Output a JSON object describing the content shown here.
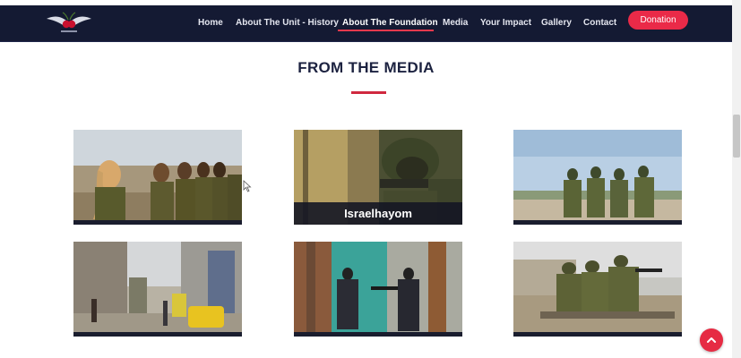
{
  "nav": {
    "items": [
      {
        "label": "Home"
      },
      {
        "label": "About The Unit - History"
      },
      {
        "label": "About The Foundation"
      },
      {
        "label": "Media"
      },
      {
        "label": "Your Impact"
      },
      {
        "label": "Gallery"
      },
      {
        "label": "Contact"
      }
    ],
    "donate_label": "Donation",
    "active_color": "#e8394d",
    "bar_color": "#141a33"
  },
  "section": {
    "title": "FROM THE MEDIA",
    "accent_color": "#d0293f"
  },
  "media_cards": [
    {
      "caption": "",
      "icon": "photo-female-soldiers"
    },
    {
      "caption": "Israelhayom",
      "icon": "photo-soldier-camouflage"
    },
    {
      "caption": "",
      "icon": "photo-soldiers-overlook"
    },
    {
      "caption": "",
      "icon": "photo-street-scene"
    },
    {
      "caption": "",
      "icon": "photo-soldiers-doorway"
    },
    {
      "caption": "",
      "icon": "photo-soldiers-rooftop"
    }
  ],
  "scroll_top": {
    "icon": "chevron-up-icon",
    "color": "#e62b43"
  }
}
